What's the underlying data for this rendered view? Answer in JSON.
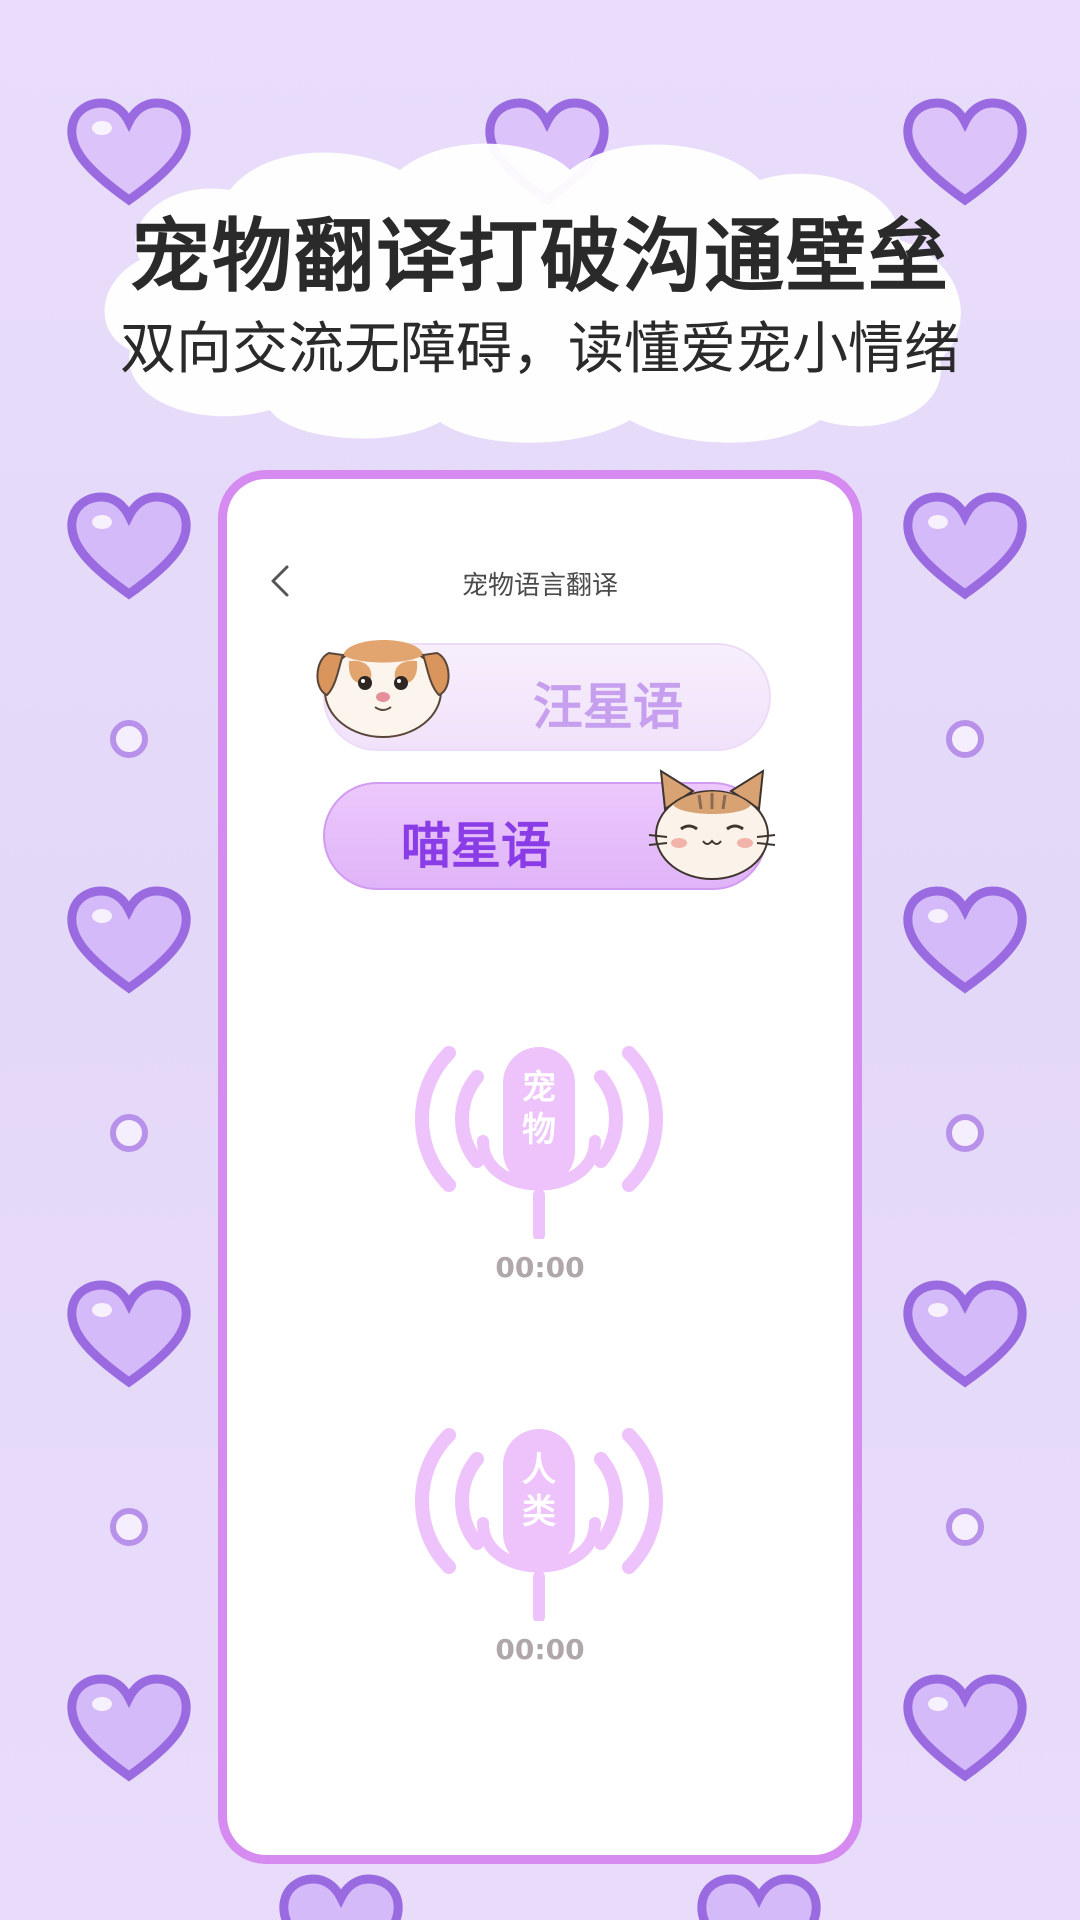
{
  "headline": "宠物翻译打破沟通壁垒",
  "subline": "双向交流无障碍，读懂爱宠小情绪",
  "phone": {
    "title": "宠物语言翻译",
    "back_icon": "chevron-left-icon",
    "modes": [
      {
        "label": "汪星语",
        "pet": "dog",
        "selected": false
      },
      {
        "label": "喵星语",
        "pet": "cat",
        "selected": true
      }
    ],
    "recorders": [
      {
        "label_chars": [
          "宠",
          "物"
        ],
        "time": "00:00"
      },
      {
        "label_chars": [
          "人",
          "类"
        ],
        "time": "00:00"
      }
    ]
  },
  "colors": {
    "background": "#e7dbfa",
    "accent": "#d68bf0",
    "selected_text": "#8a3ce6",
    "unselected_text": "#c6a0ee",
    "mic": "#eec2fb",
    "heart": "#a97ae6"
  }
}
